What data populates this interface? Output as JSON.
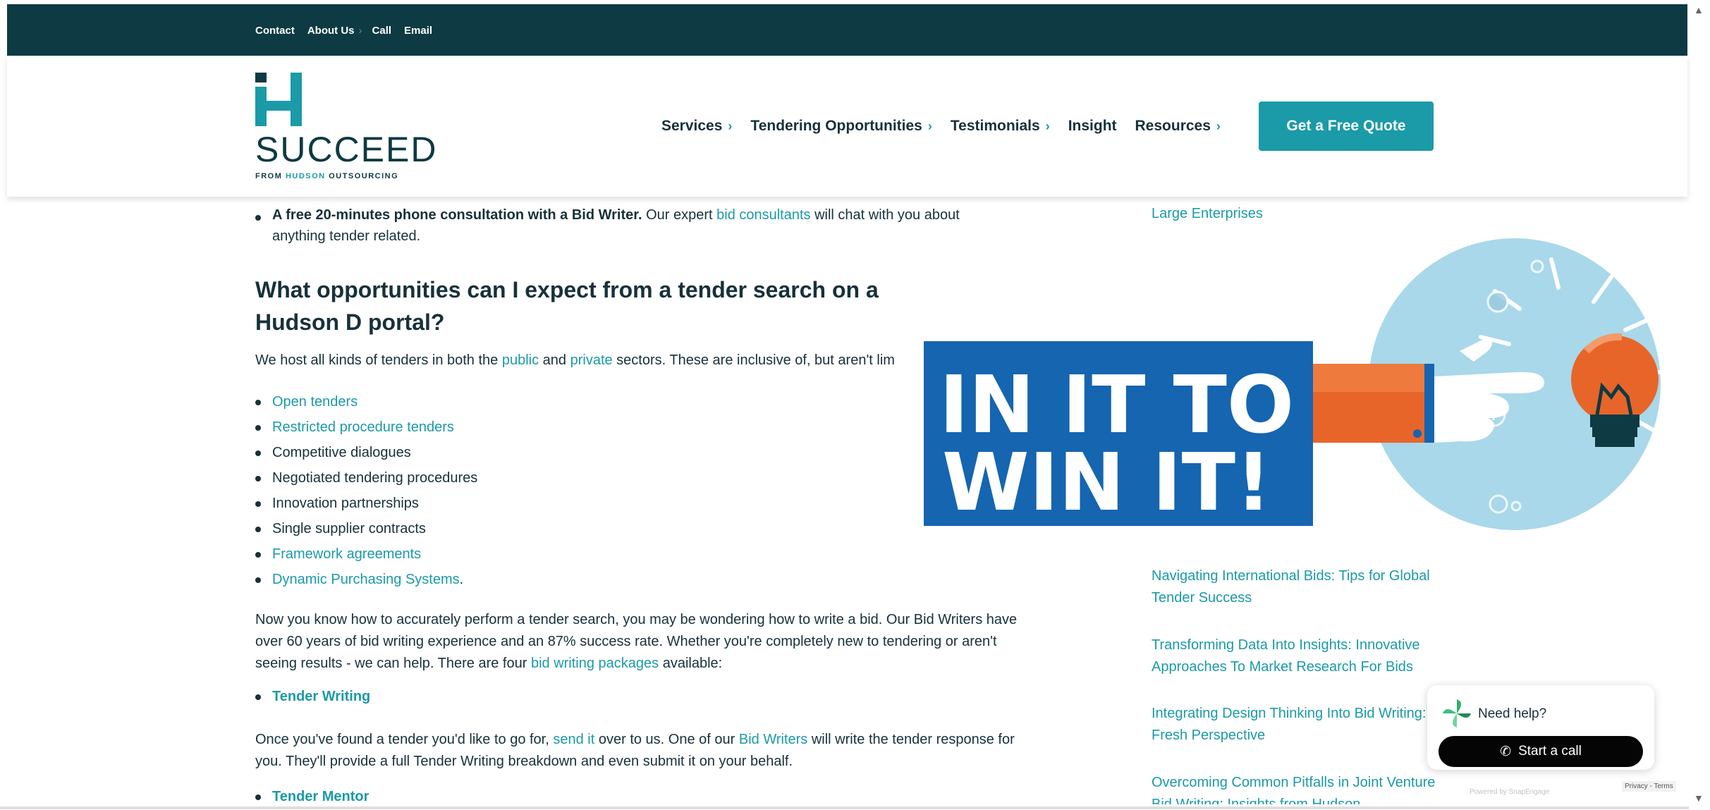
{
  "topbar": {
    "links": [
      "Contact",
      "About Us",
      "Call",
      "Email"
    ],
    "separator": "›"
  },
  "header": {
    "logo_text": "SUCCEED",
    "logo_sub_prefix": "FROM ",
    "logo_sub_accent": "HUDSON",
    "logo_sub_suffix": " OUTSOURCING",
    "nav": [
      {
        "label": "Services",
        "has_chevron": true
      },
      {
        "label": "Tendering Opportunities",
        "has_chevron": true
      },
      {
        "label": "Testimonials",
        "has_chevron": true
      },
      {
        "label": "Insight",
        "has_chevron": false
      },
      {
        "label": "Resources",
        "has_chevron": true
      }
    ],
    "cta": "Get a Free Quote"
  },
  "main": {
    "first_bullet_bold": "A free 20-minutes phone consultation with a Bid Writer.",
    "first_bullet_text1": " Our expert ",
    "first_bullet_link": "bid consultants",
    "first_bullet_text2": " will chat with you about anything tender related.",
    "heading": "What opportunities can I expect from a tender search on a Hudson D portal?",
    "intro_text1": "We host all kinds of tenders in both the ",
    "intro_link1": "public",
    "intro_text2": " and ",
    "intro_link2": "private",
    "intro_text3": " sectors. These are inclusive of, but aren't lim",
    "tender_types": [
      {
        "label": "Open tenders",
        "link": true
      },
      {
        "label": "Restricted procedure tenders",
        "link": true
      },
      {
        "label": "Competitive dialogues",
        "link": false
      },
      {
        "label": "Negotiated tendering procedures",
        "link": false
      },
      {
        "label": "Innovation partnerships",
        "link": false
      },
      {
        "label": "Single supplier contracts",
        "link": false
      },
      {
        "label": "Framework agreements",
        "link": true
      },
      {
        "label": "Dynamic Purchasing Systems",
        "link": true
      }
    ],
    "dps_period": ".",
    "para1_text1": "Now you know how to accurately perform a tender search, you may be wondering how to write a bid. Our Bid Writers have over 60 years of bid writing experience and an 87% success rate. Whether you're completely new to tendering or aren't seeing results - we can help. There are four ",
    "para1_link": "bid writing packages",
    "para1_text2": " available:",
    "package1": "Tender Writing",
    "para2_text1": "Once you've found a tender you'd like to go for, ",
    "para2_link1": "send it",
    "para2_text2": " over to us. One of our ",
    "para2_link2": "Bid Writers",
    "para2_text3": " will write the tender response for you. They'll provide a full Tender Writing breakdown and even submit it on your behalf.",
    "package2": "Tender Mentor"
  },
  "sidebar": {
    "links": [
      "Large Enterprises",
      "Navigating International Bids: Tips for Global Tender Success",
      "Transforming Data Into Insights: Innovative Approaches To Market Research For Bids",
      "Integrating Design Thinking Into Bid Writing: A Fresh Perspective",
      "Overcoming Common Pitfalls in Joint Venture Bid Writing: Insights from Hudson"
    ]
  },
  "promo": {
    "line1": "IN IT TO",
    "line2": "WIN IT!"
  },
  "help_widget": {
    "title": "Need help?",
    "button": "Start a call",
    "powered": "Powered by SnapEngage",
    "privacy": "Privacy - Terms"
  },
  "colors": {
    "dark_teal": "#0d3a43",
    "accent_teal": "#1b9aa8",
    "promo_blue": "#1565b0",
    "promo_orange": "#e8652a",
    "circle_blue": "#a9d8ea"
  }
}
